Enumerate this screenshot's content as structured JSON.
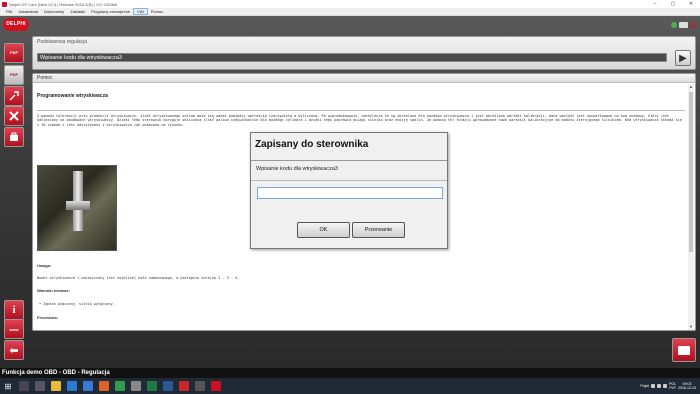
{
  "window": {
    "title": "Delphi DS Cars (New VCI) | Release 2016.2(B) | VCI 100366",
    "controls": [
      "–",
      "▢",
      "✕"
    ]
  },
  "menu": {
    "items": [
      "Plik",
      "Ustawienia",
      "Dokumenty",
      "Zakładki",
      "Programy zewnętrzne",
      "VIN",
      "Pomoc"
    ]
  },
  "logo": "DELPHI",
  "sidebar": {
    "buttons": [
      "PDF",
      "PDF",
      "",
      "",
      ""
    ]
  },
  "header_panel": {
    "section_title": "Podstawowa regulacja",
    "current_step": "Wpisanie kodu dla wtryskiwacza3",
    "next_arrow": "▶"
  },
  "help_panel": {
    "tab_label": "Pomoc",
    "heading": "Programowanie wtryskiwacza",
    "paragraph": "Z powodu tolerancji przy produkcji wtryskiwaczy, ilość wtryskiwanego paliwa może się wahać pomiędzy wartością rzeczywistą a wyliczoną. Po wyprodukowaniu, odchylenia te są określane dla każdego wtryskiwacza i jest określana wartość kalibracji, dana wartość jest konwertowana na kod znakowy, który jest naniesiony na obudowach wtryskiwaczy. Dzięki temu sterownik koryguje obliczoną ilość paliwa indywidualnie dla każdego cylindra i dzięki temu poprawia osiągi silnika oraz emisję spalin. Za pomocą tej funkcji wprowadzone nowe wartości kalibracyjne do modułu sterującego silnikiem. Kod wtryskiwacza składa się z 16 znaków i jest odczytywany z wtryskiwacza jak pokazano na rysunku.",
    "uwaga_label": "Uwaga:",
    "uwaga_text": "Numer wtryskiwacza 1 umieszczony jest najbliżej koła zamachowego, a następnie kolejno 2 - 3 - 4.",
    "conditions_label": "Warunki testowe:",
    "condition_1": "• Zapłon włączony, silnik wyłączony.",
    "procedure_label": "Procedura:"
  },
  "dialog": {
    "title": "Zapisany do sterownika",
    "message": "Wpisanie kodu dla wtryskiwacza3",
    "input_value": "",
    "ok_label": "OK",
    "cancel_label": "Przerwanie"
  },
  "bottom_left": {
    "info": "i",
    "www": "www",
    "back": "⬅"
  },
  "status_bar": {
    "text": "Funkcja demo OBD - OBD - Regulacja"
  },
  "taskbar": {
    "start": "⊞",
    "tray_text": "Pulpit",
    "lang_1": "POL",
    "lang_2": "PLP",
    "time": "09:03",
    "date": "2016-12-23"
  },
  "colors": {
    "accent_red": "#c8102e",
    "dark_bg": "#2b2b2b"
  }
}
